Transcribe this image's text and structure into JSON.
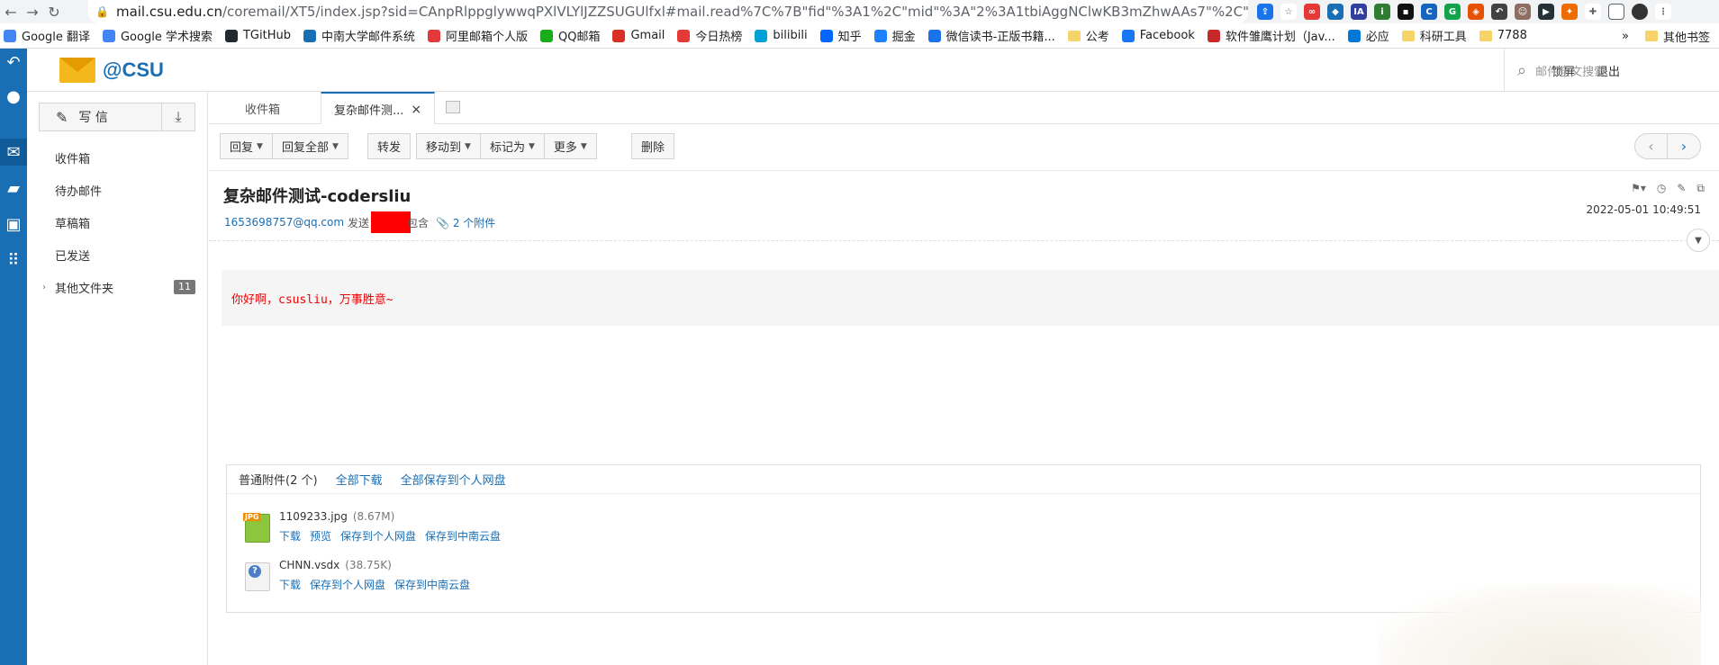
{
  "browser": {
    "url_host": "mail.csu.edu.cn",
    "url_path": "/coremail/XT5/index.jsp?sid=CAnpRlppglywwqPXlVLYlJZZSUGUlfxl#mail.read%7C%7B\"fid\"%3A1%2C\"mid\"%3A\"2%3A1tbiAggNClwKB3mZhwAAs7\"%2C\"mboxa...",
    "bookmarks": [
      {
        "label": "Google 翻译",
        "icon": "google-translate-icon",
        "color": "#4285f4"
      },
      {
        "label": "Google 学术搜索",
        "icon": "google-scholar-icon",
        "color": "#4285f4"
      },
      {
        "label": "TGitHub",
        "icon": "github-icon",
        "color": "#24292e"
      },
      {
        "label": "中南大学邮件系统",
        "icon": "csu-mail-icon",
        "color": "#1a6eb3"
      },
      {
        "label": "阿里邮箱个人版",
        "icon": "aliyun-mail-icon",
        "color": "#e4393c"
      },
      {
        "label": "QQ邮箱",
        "icon": "qq-mail-icon",
        "color": "#1aad19"
      },
      {
        "label": "Gmail",
        "icon": "gmail-icon",
        "color": "#d93025"
      },
      {
        "label": "今日热榜",
        "icon": "rebang-icon",
        "color": "#e53935"
      },
      {
        "label": "bilibili",
        "icon": "bilibili-icon",
        "color": "#00a1d6"
      },
      {
        "label": "知乎",
        "icon": "zhihu-icon",
        "color": "#0066ff"
      },
      {
        "label": "掘金",
        "icon": "juejin-icon",
        "color": "#1e80ff"
      },
      {
        "label": "微信读书-正版书籍...",
        "icon": "weread-icon",
        "color": "#1a73e8"
      },
      {
        "label": "公考",
        "icon": "folder-icon",
        "color": "#f6d46a"
      },
      {
        "label": "Facebook",
        "icon": "facebook-icon",
        "color": "#1877f2"
      },
      {
        "label": "软件雏鹰计划（Jav...",
        "icon": "software-icon",
        "color": "#c62828"
      },
      {
        "label": "必应",
        "icon": "bing-icon",
        "color": "#0078d4"
      },
      {
        "label": "科研工具",
        "icon": "folder-icon",
        "color": "#f6d46a"
      },
      {
        "label": "7788",
        "icon": "folder-icon",
        "color": "#f6d46a"
      }
    ],
    "bookmarks_more": "»",
    "other_bookmarks": "其他书签"
  },
  "app": {
    "logo_text": "@CSU",
    "lock_label": "锁屏",
    "logout_label": "退出",
    "search_placeholder": "邮件全文搜索"
  },
  "sidebar": {
    "compose_label": "写 信",
    "folders": [
      {
        "label": "收件箱"
      },
      {
        "label": "待办邮件"
      },
      {
        "label": "草稿箱"
      },
      {
        "label": "已发送"
      },
      {
        "label": "其他文件夹",
        "count": "11"
      }
    ]
  },
  "tabs": [
    {
      "label": "收件箱"
    },
    {
      "label": "复杂邮件测...",
      "close": "×"
    }
  ],
  "toolbar": {
    "reply": "回复",
    "reply_all": "回复全部",
    "forward": "转发",
    "move_to": "移动到",
    "mark_as": "标记为",
    "more": "更多",
    "delete": "删除"
  },
  "mail": {
    "subject": "复杂邮件测试-codersliu",
    "sender": "1653698757@qq.com",
    "sent_to_prefix": "发送",
    "sent_to_suffix": "包含",
    "attach_summary": "2 个附件",
    "date": "2022-05-01 10:49:51",
    "body": "你好啊，csusliu，万事胜意~"
  },
  "attachments": {
    "title": "普通附件(2 个)",
    "download_all": "全部下载",
    "save_all": "全部保存到个人网盘",
    "files": [
      {
        "name": "1109233.jpg",
        "size": "(8.67M)",
        "links": [
          "下载",
          "预览",
          "保存到个人网盘",
          "保存到中南云盘"
        ]
      },
      {
        "name": "CHNN.vsdx",
        "size": "(38.75K)",
        "links": [
          "下载",
          "保存到个人网盘",
          "保存到中南云盘"
        ]
      }
    ]
  },
  "colors": {
    "accent": "#1a6eb3",
    "body_text": "#ee0000",
    "redaction": "#ff0000"
  }
}
